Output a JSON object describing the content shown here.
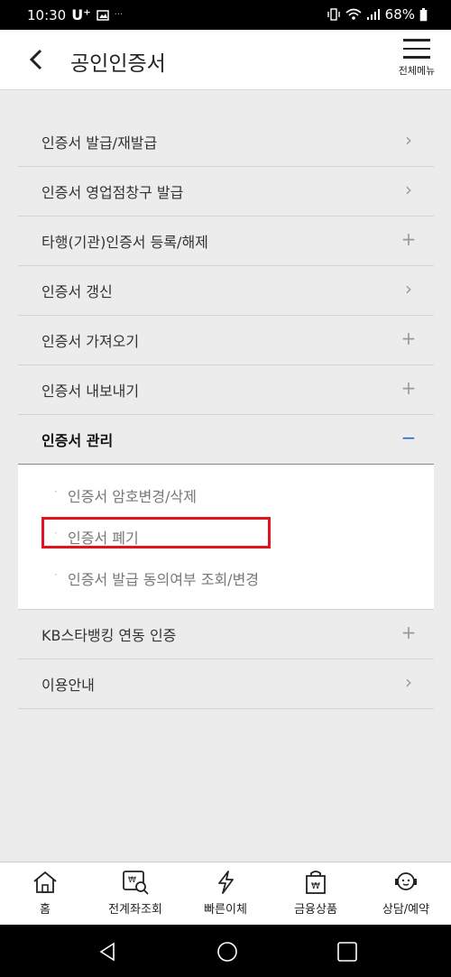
{
  "status": {
    "time": "10:30",
    "carrier": "U⁺",
    "battery": "68%"
  },
  "header": {
    "title": "공인인증서",
    "menu_label": "전체메뉴"
  },
  "menu_items": [
    {
      "label": "인증서 발급/재발급",
      "indicator": "›"
    },
    {
      "label": "인증서 영업점창구 발급",
      "indicator": "›"
    },
    {
      "label": "타행(기관)인증서 등록/해제",
      "indicator": "+"
    },
    {
      "label": "인증서 갱신",
      "indicator": "›"
    },
    {
      "label": "인증서 가져오기",
      "indicator": "+"
    },
    {
      "label": "인증서 내보내기",
      "indicator": "+"
    }
  ],
  "expanded": {
    "label": "인증서 관리",
    "indicator": "−",
    "subitems": [
      "인증서 암호변경/삭제",
      "인증서 폐기",
      "인증서 발급 동의여부 조회/변경"
    ]
  },
  "menu_items_after": [
    {
      "label": "KB스타뱅킹 연동 인증",
      "indicator": "+"
    },
    {
      "label": "이용안내",
      "indicator": "›"
    }
  ],
  "tabs": [
    "홈",
    "전계좌조회",
    "빠른이체",
    "금융상품",
    "상담/예약"
  ],
  "colors": {
    "accent": "#1b6fd1",
    "highlight": "#e0141e",
    "background": "#ececec"
  }
}
